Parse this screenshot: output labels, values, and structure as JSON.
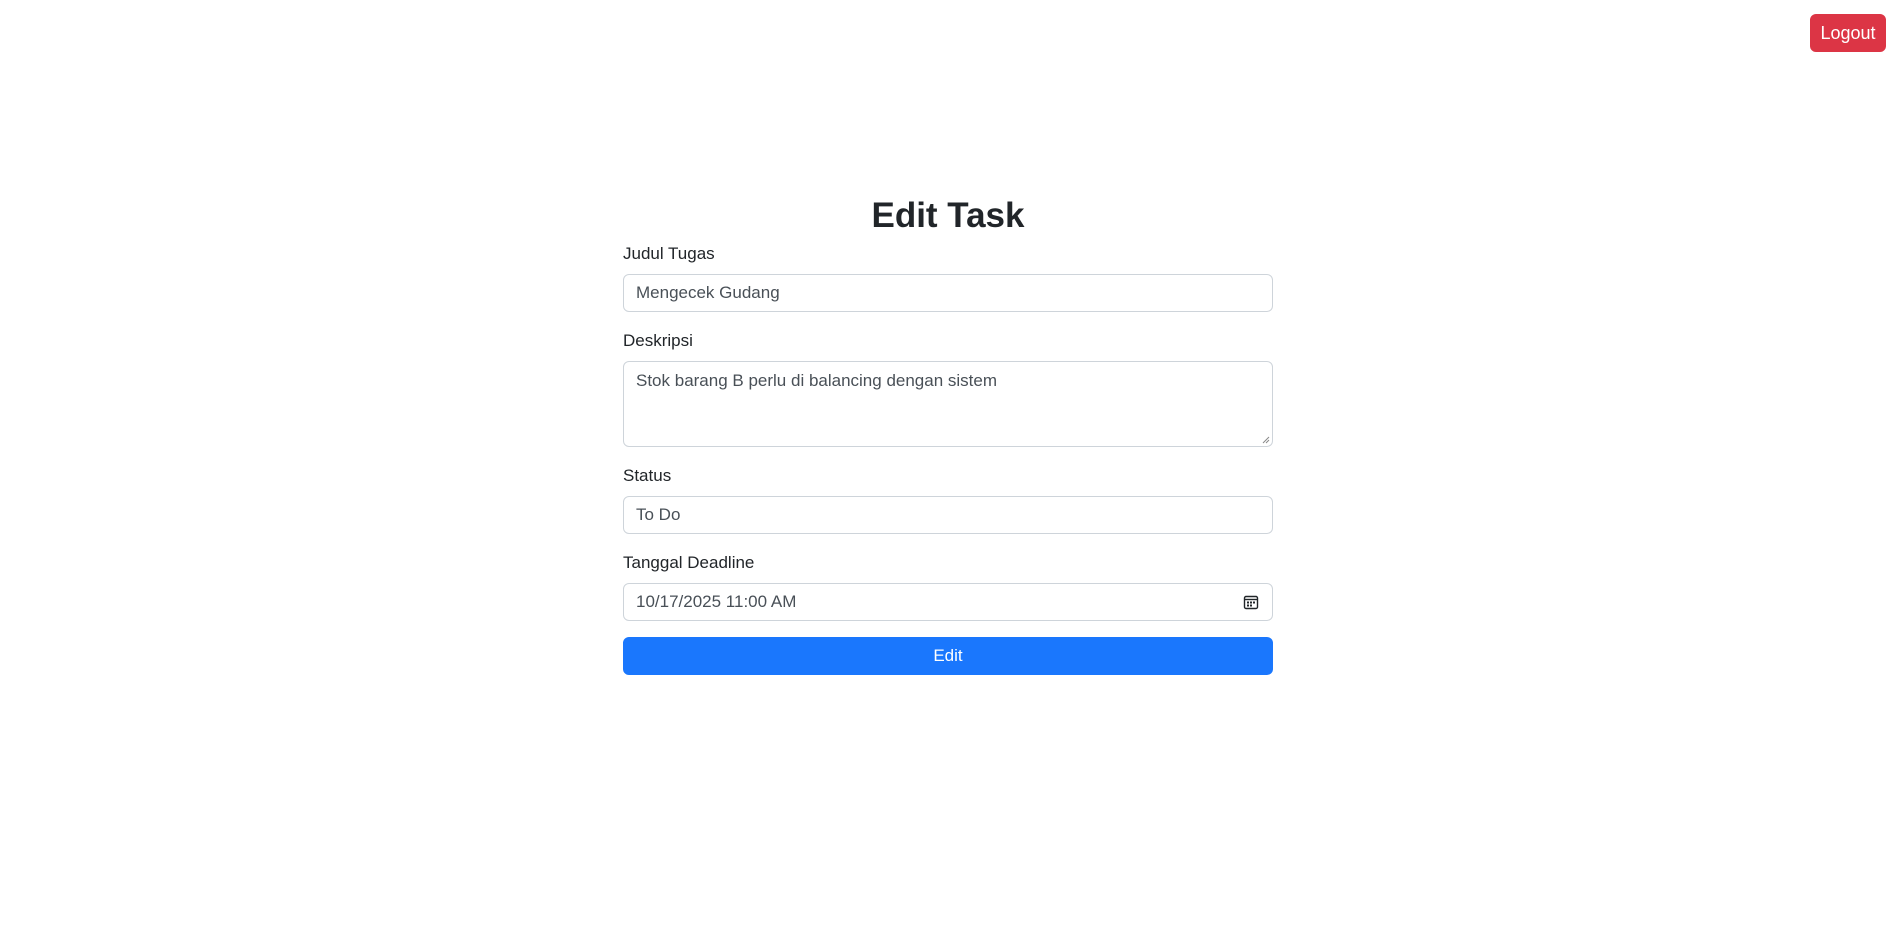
{
  "header": {
    "logout_label": "Logout"
  },
  "form": {
    "title": "Edit Task",
    "judul": {
      "label": "Judul Tugas",
      "value": "Mengecek Gudang"
    },
    "deskripsi": {
      "label": "Deskripsi",
      "value": "Stok barang B perlu di balancing dengan sistem"
    },
    "status": {
      "label": "Status",
      "value": "To Do"
    },
    "deadline": {
      "label": "Tanggal Deadline",
      "value": "10/17/2025 11:00 AM",
      "icon": "calendar-icon"
    },
    "submit_label": "Edit"
  },
  "colors": {
    "logout_bg": "#dc3545",
    "submit_bg": "#1a77fd",
    "input_border": "#ced4da"
  }
}
